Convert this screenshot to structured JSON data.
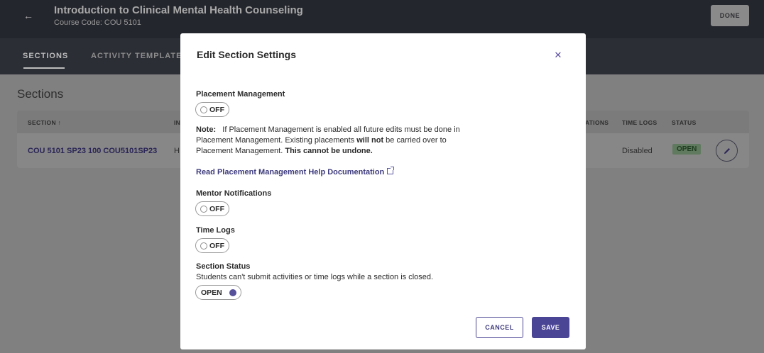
{
  "header": {
    "course_title": "Introduction to Clinical Mental Health Counseling",
    "course_code": "Course Code: COU 5101",
    "done_label": "DONE",
    "back_icon": "arrow-left-icon"
  },
  "tabs": [
    {
      "label": "SECTIONS",
      "active": true
    },
    {
      "label": "ACTIVITY TEMPLATES",
      "active": false
    }
  ],
  "page": {
    "sections_heading": "Sections"
  },
  "table": {
    "columns": [
      "SECTION ↑",
      "IN",
      "ATIONS",
      "TIME LOGS",
      "STATUS"
    ],
    "rows": [
      {
        "section": "COU 5101 SP23 100 COU5101SP23",
        "instructor_partial": "H",
        "time_logs": "Disabled",
        "status": "OPEN"
      }
    ]
  },
  "modal": {
    "title": "Edit Section Settings",
    "close_icon": "close-icon",
    "placement_management": {
      "label": "Placement Management",
      "toggle_text": "OFF"
    },
    "note": {
      "prefix": "Note:",
      "text1": "If Placement Management is enabled all future edits must be done in Placement Management. Existing placements ",
      "bold1": "will not",
      "text2": " be carried over to Placement Management. ",
      "bold2": "This cannot be undone."
    },
    "help_link": "Read Placement Management Help Documentation",
    "mentor_notifications": {
      "label": "Mentor Notifications",
      "toggle_text": "OFF"
    },
    "time_logs": {
      "label": "Time Logs",
      "toggle_text": "OFF"
    },
    "section_status": {
      "label": "Section Status",
      "help": "Students can't submit activities or time logs while a section is closed.",
      "toggle_text": "OPEN"
    },
    "cancel_label": "CANCEL",
    "save_label": "SAVE"
  },
  "colors": {
    "accent": "#4b4596",
    "overlay": "#808080",
    "status_open": "#5f7a5f"
  }
}
